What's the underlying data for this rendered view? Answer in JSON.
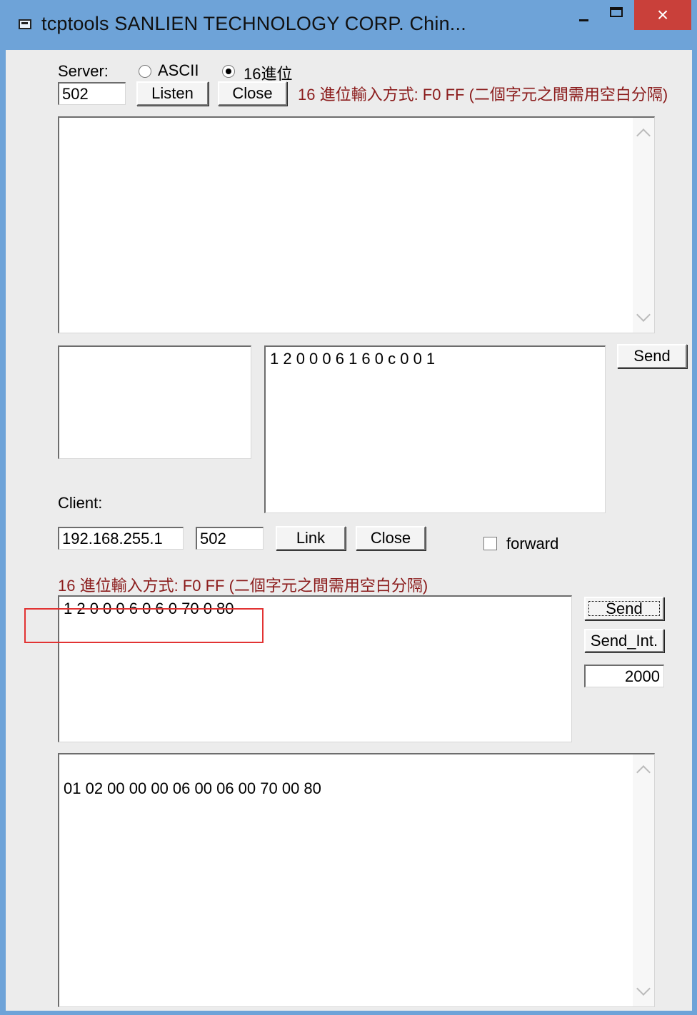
{
  "window": {
    "title": "tcptools    SANLIEN TECHNOLOGY CORP.    Chin..."
  },
  "server": {
    "label": "Server:",
    "radio_ascii": "ASCII",
    "radio_hex": "16進位",
    "port": "502",
    "listen": "Listen",
    "close": "Close",
    "hex_hint": "16 進位輸入方式: F0 FF (二個字元之間需用空白分隔)",
    "receive_text": "",
    "send_text": "1 2 0 0 0 6 1 6 0 c 0 0 1",
    "send_button": "Send"
  },
  "client": {
    "label": "Client:",
    "ip": "192.168.255.1",
    "port": "502",
    "link": "Link",
    "close": "Close",
    "forward": "forward",
    "hex_hint": "16 進位輸入方式: F0 FF (二個字元之間需用空白分隔)",
    "input_text": "1 2 0 0 0 6 0 6 0 70 0 80",
    "send_button": "Send",
    "send_interval_button": "Send_Int.",
    "interval_value": "2000",
    "output_text": "01 02 00 00 00 06 00 06 00 70 00 80"
  }
}
